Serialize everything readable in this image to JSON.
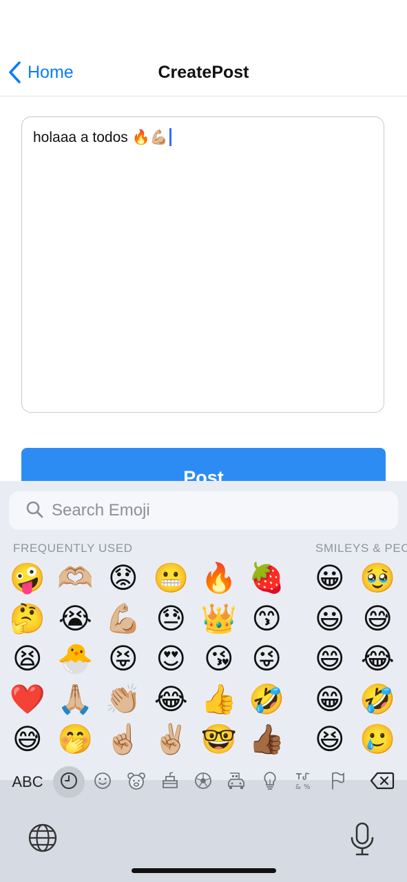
{
  "navbar": {
    "back_label": "Home",
    "title": "CreatePost"
  },
  "composer": {
    "text": "holaaa a todos 🔥💪🏼"
  },
  "post_button": {
    "label": "Post"
  },
  "keyboard": {
    "search_placeholder": "Search Emoji",
    "sections": [
      {
        "label": "FREQUENTLY USED",
        "columns": [
          [
            "🤪",
            "🤔",
            "😫",
            "❤️",
            "😅"
          ],
          [
            "🫶🏼",
            "😭",
            "🐣",
            "🙏🏼",
            "🤭"
          ],
          [
            "😟",
            "💪🏼",
            "😝",
            "👏🏼",
            "☝🏼"
          ],
          [
            "😬",
            "😓",
            "😍",
            "😂",
            "✌🏼"
          ],
          [
            "🔥",
            "👑",
            "😘",
            "👍",
            "🤓"
          ],
          [
            "🍓",
            "😙",
            "😜",
            "🤣",
            "👍🏾"
          ]
        ]
      },
      {
        "label": "SMILEYS & PEOPLE",
        "columns": [
          [
            "😀",
            "😃",
            "😄",
            "😁",
            "😆"
          ],
          [
            "🥹",
            "😅",
            "😂",
            "🤣",
            "🥲"
          ]
        ]
      }
    ],
    "abc_label": "ABC",
    "categories": [
      {
        "icon": "clock-icon",
        "active": true
      },
      {
        "icon": "smiley-icon",
        "active": false
      },
      {
        "icon": "bear-icon",
        "active": false
      },
      {
        "icon": "food-icon",
        "active": false
      },
      {
        "icon": "soccer-ball-icon",
        "active": false
      },
      {
        "icon": "car-icon",
        "active": false
      },
      {
        "icon": "lightbulb-icon",
        "active": false
      },
      {
        "icon": "symbols-icon",
        "active": false
      },
      {
        "icon": "flag-icon",
        "active": false
      }
    ]
  },
  "colors": {
    "accent": "#0a7bff",
    "post_button": "#2d8cf4",
    "caret": "#2f6cff",
    "keyboard_bg": "#d6dbe3"
  }
}
